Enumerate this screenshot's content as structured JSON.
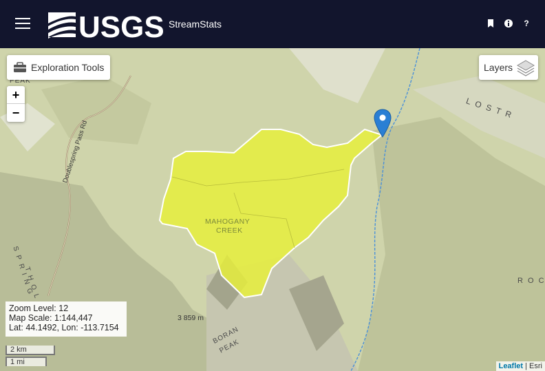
{
  "header": {
    "app_name": "StreamStats",
    "logo_text": "USGS",
    "icons": [
      "bookmark-icon",
      "info-icon",
      "help-icon"
    ],
    "help_glyph": "?",
    "colors": {
      "header_bg": "#12152d",
      "logo": "#ffffff"
    }
  },
  "map": {
    "exploration_tools_label": "Exploration Tools",
    "layers_label": "Layers",
    "zoom_in_label": "+",
    "zoom_out_label": "−",
    "info": {
      "zoom_level": "Zoom Level: 12",
      "map_scale": "Map Scale: 1:144,447",
      "lat_lon": "Lat: 44.1492, Lon: -113.7154"
    },
    "scale_bar": {
      "km": "2 km",
      "mi": "1 mi"
    },
    "attribution": {
      "leaflet": "Leaflet",
      "esri": "Esri",
      "separator": "|"
    },
    "labels": {
      "basin_line1": "MAHOGANY",
      "basin_line2": "CREEK",
      "lost_river": "L O S T   R",
      "road": "Doublespring Pass Rd",
      "springs": "S P R I N G",
      "thol": "T H O L",
      "boran_peak_1": "BORAN",
      "boran_peak_2": "PEAK",
      "peak_top": "PEAK",
      "elevation": "3 859 m",
      "rock": "R O C K"
    },
    "colors": {
      "watershed_fill": "#e6ee3c",
      "stream": "#4a90d9",
      "marker": "#2a7fd4",
      "terrain": "#cdd2a8"
    }
  }
}
